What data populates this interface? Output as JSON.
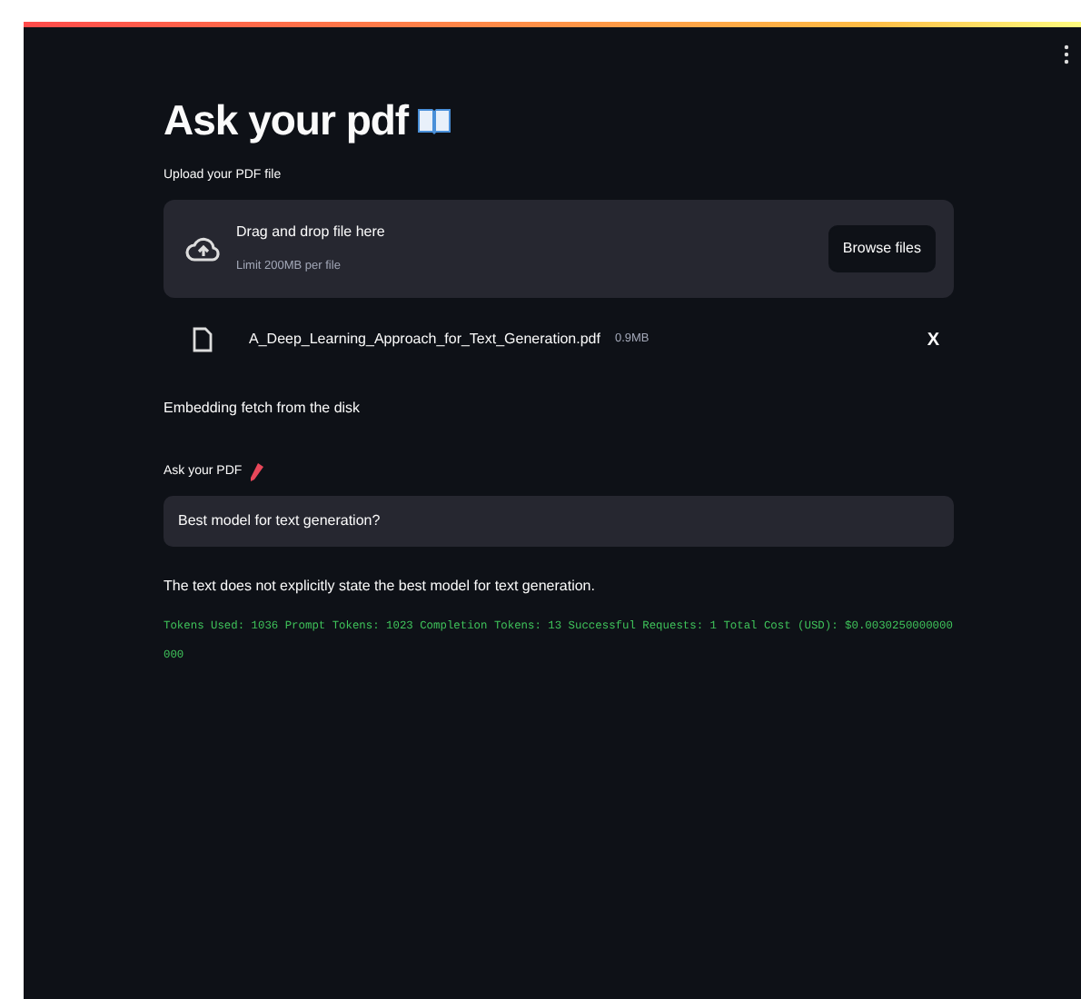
{
  "app": {
    "title": "Ask your pdf",
    "uploader": {
      "label": "Upload your PDF file",
      "drop_text": "Drag and drop file here",
      "limit": "Limit 200MB per file",
      "button": "Browse files"
    },
    "file": {
      "name": "A_Deep_Learning_Approach_for_Text_Generation.pdf",
      "size": "0.9MB",
      "remove": "X"
    },
    "status": "Embedding fetch from the disk",
    "question": {
      "label": "Ask your PDF",
      "value": "Best model for text generation?"
    },
    "answer": "The text does not explicitly state the best model for text generation.",
    "usage": "Tokens Used: 1036 Prompt Tokens: 1023 Completion Tokens: 13 Successful Requests: 1 Total Cost (USD): $0.0030250000000000"
  }
}
